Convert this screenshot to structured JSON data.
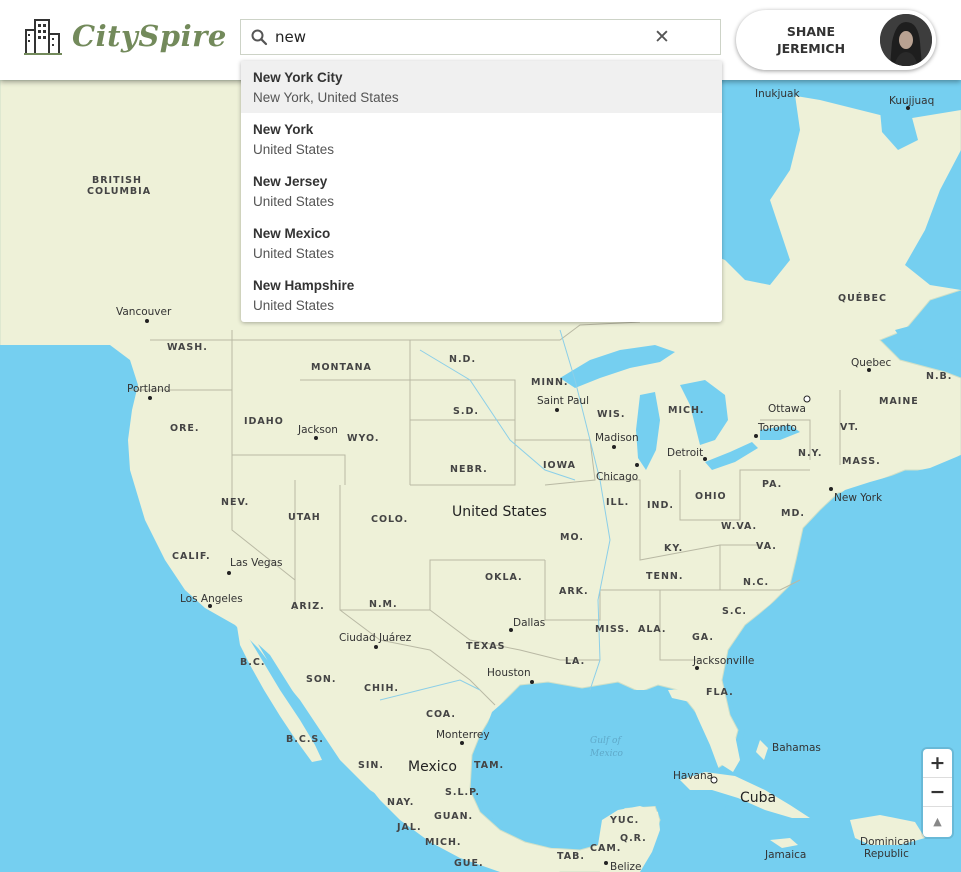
{
  "app": {
    "name": "CitySpire"
  },
  "search": {
    "value": "new",
    "placeholder": ""
  },
  "suggestions": [
    {
      "name": "New York City",
      "sub": "New York, United States"
    },
    {
      "name": "New York",
      "sub": "United States"
    },
    {
      "name": "New Jersey",
      "sub": "United States"
    },
    {
      "name": "New Mexico",
      "sub": "United States"
    },
    {
      "name": "New Hampshire",
      "sub": "United States"
    }
  ],
  "user": {
    "name_line1": "SHANE",
    "name_line2": "JEREMICH"
  },
  "map": {
    "countries": {
      "us": "United States",
      "mexico": "Mexico",
      "cuba": "Cuba"
    },
    "regions": {
      "british_columbia_1": "BRITISH",
      "british_columbia_2": "COLUMBIA",
      "quebec": "QUÉBEC",
      "wa": "WASH.",
      "or": "ORE.",
      "id": "IDAHO",
      "mt": "MONTANA",
      "wy": "WYO.",
      "nd": "N.D.",
      "sd": "S.D.",
      "mn": "MINN.",
      "wi": "WIS.",
      "mi": "MICH.",
      "ne": "NEBR.",
      "ia": "IOWA",
      "il": "ILL.",
      "in": "IND.",
      "oh": "OHIO",
      "pa": "PA.",
      "ny": "N.Y.",
      "vt": "VT.",
      "me": "MAINE",
      "ma": "MASS.",
      "nb": "N.B.",
      "md": "MD.",
      "wv": "W.VA.",
      "va": "VA.",
      "ky": "KY.",
      "nv": "NEV.",
      "ut": "UTAH",
      "co": "COLO.",
      "ca": "CALIF.",
      "az": "ARIZ.",
      "nm": "N.M.",
      "ok": "OKLA.",
      "mo": "MO.",
      "ar": "ARK.",
      "tn": "TENN.",
      "nc": "N.C.",
      "sc": "S.C.",
      "tx": "TEXAS",
      "la": "LA.",
      "ms": "MISS.",
      "al": "ALA.",
      "ga": "GA.",
      "fl": "FLA.",
      "bc": "B.C.",
      "son": "SON.",
      "chih": "CHIH.",
      "bcs": "B.C.S.",
      "coa": "COA.",
      "tam": "TAM.",
      "sin": "SIN.",
      "nay": "NAY.",
      "slp": "S.L.P.",
      "gto": "GUAN.",
      "jal": "JAL.",
      "mich": "MICH.",
      "gue": "GUE.",
      "tab": "TAB.",
      "cam": "CAM.",
      "qr": "Q.R.",
      "yuc": "YUC."
    },
    "cities": {
      "inukjuak": "Inukjuak",
      "kuujjuaq": "Kuujjuaq",
      "vancouver": "Vancouver",
      "portland": "Portland",
      "jackson": "Jackson",
      "saint_paul": "Saint Paul",
      "madison": "Madison",
      "chicago": "Chicago",
      "detroit": "Detroit",
      "ottawa": "Ottawa",
      "toronto": "Toronto",
      "quebec_city": "Quebec",
      "new_york": "New York",
      "las_vegas": "Las Vegas",
      "los_angeles": "Los Angeles",
      "dallas": "Dallas",
      "houston": "Houston",
      "ciudad_juarez": "Ciudad Juárez",
      "monterrey": "Monterrey",
      "jacksonville": "Jacksonville",
      "havana": "Havana",
      "bahamas": "Bahamas",
      "jamaica": "Jamaica",
      "belize": "Belize",
      "dominican_1": "Dominican",
      "dominican_2": "Republic"
    },
    "water": {
      "gulf_1": "Gulf of",
      "gulf_2": "Mexico"
    }
  },
  "controls": {
    "zoom_in": "+",
    "zoom_out": "−",
    "compass": "▲"
  },
  "colors": {
    "land": "#eef1d8",
    "water": "#75cff0",
    "brand_green": "#738a5b",
    "borders": "#b9b9a4"
  }
}
